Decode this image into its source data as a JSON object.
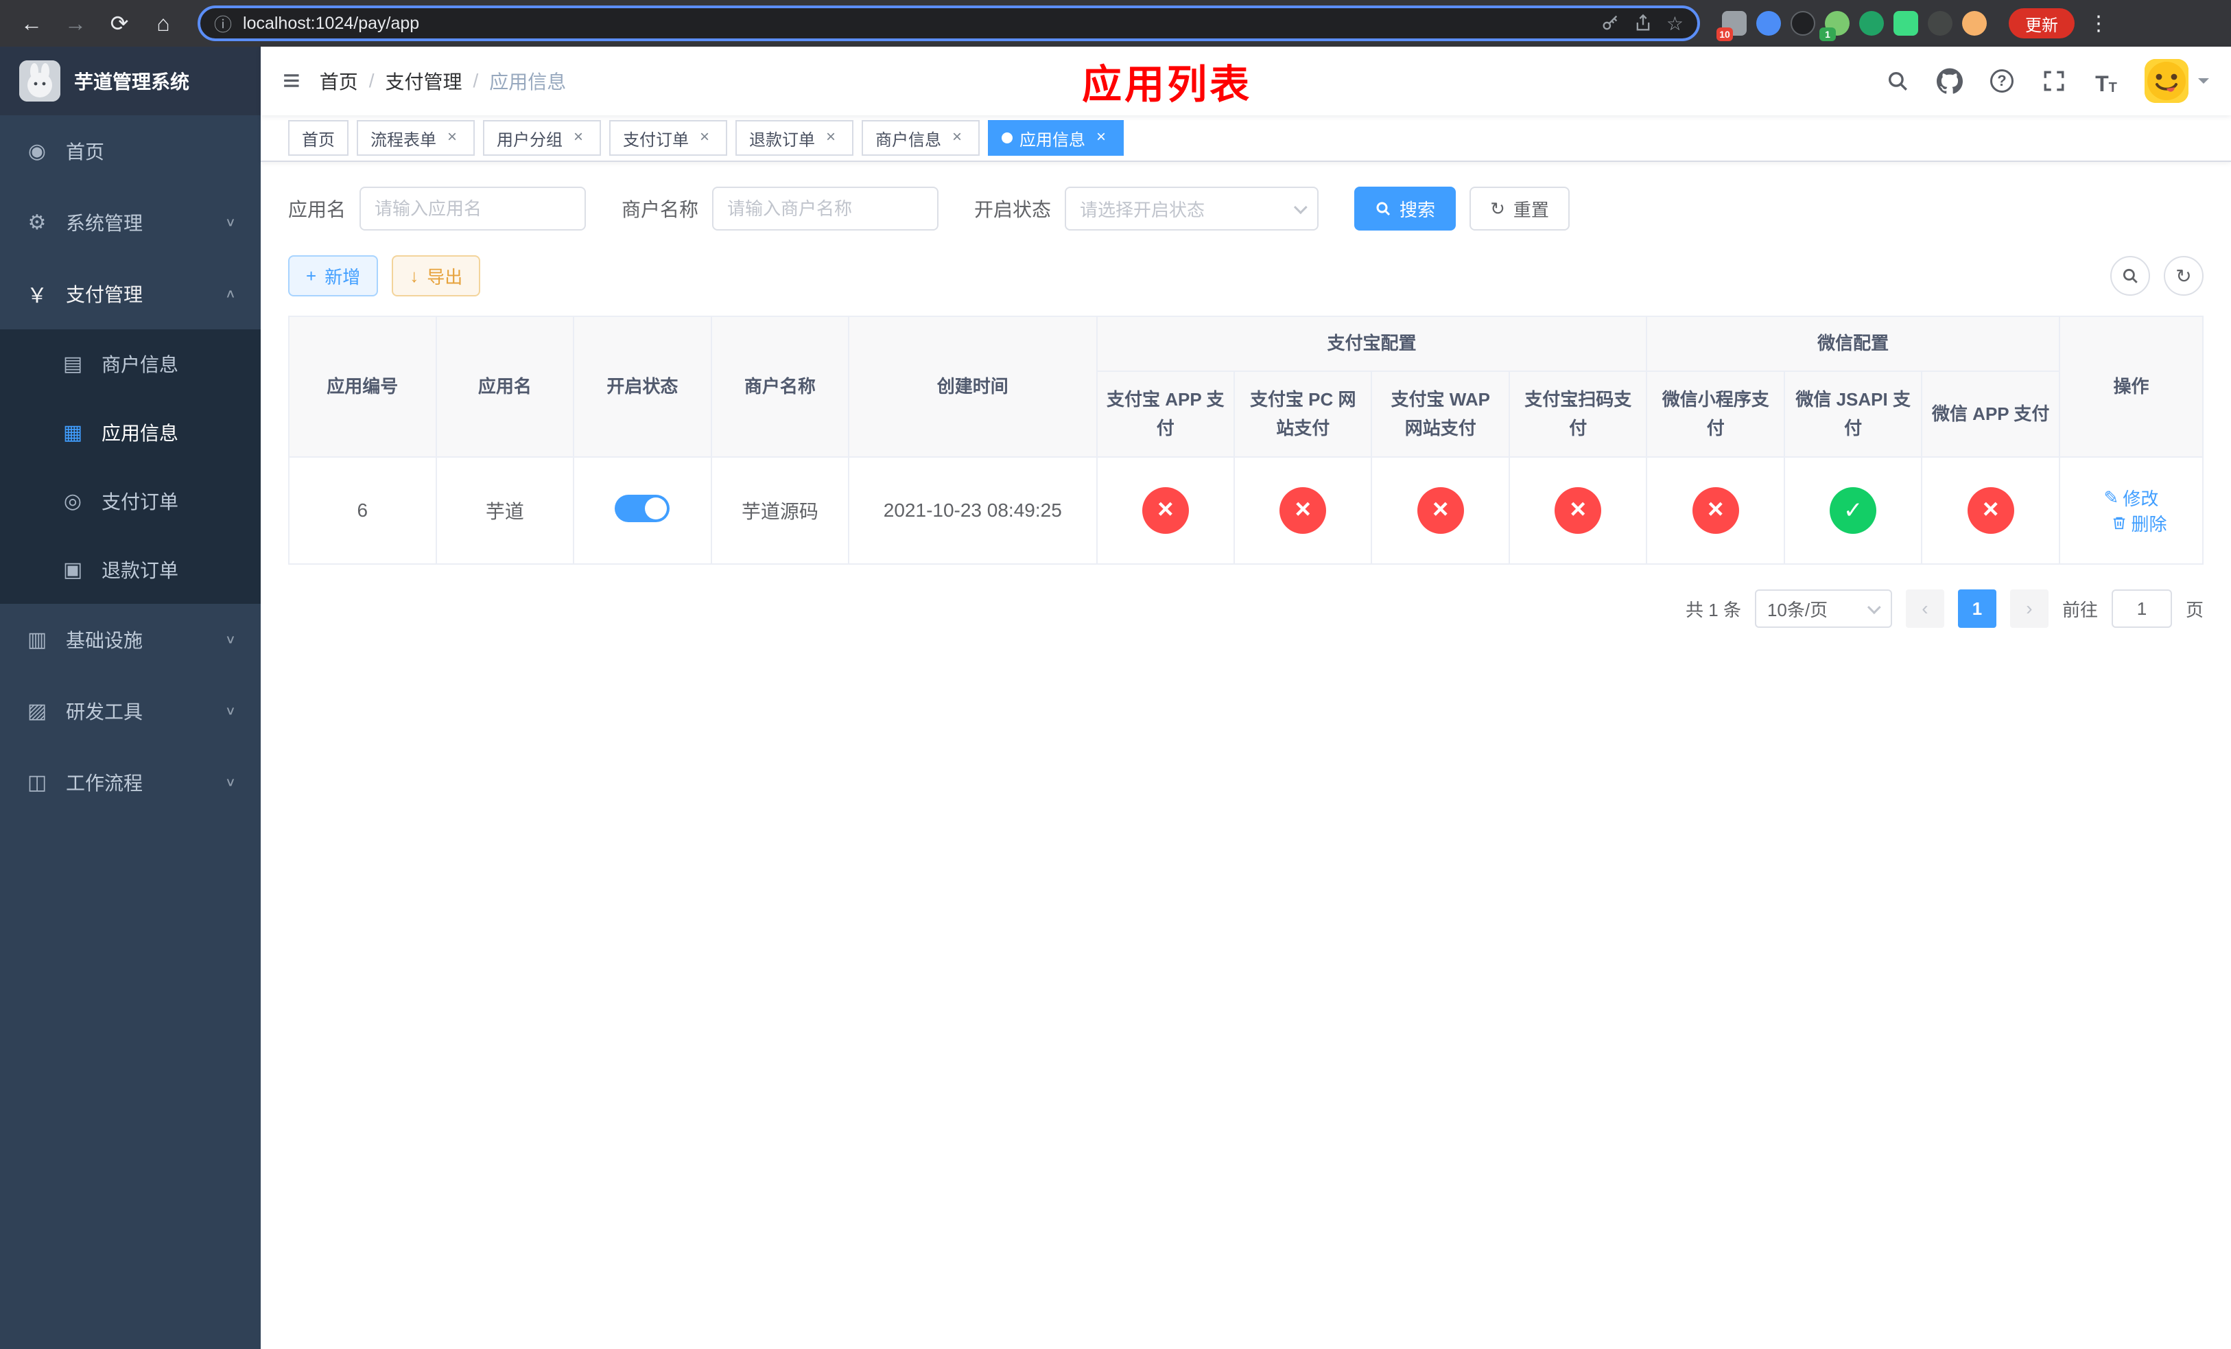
{
  "browser": {
    "url": "localhost:1024/pay/app",
    "update_button": "更新",
    "ext_badges": {
      "puzzle": "10",
      "avatar": "1"
    }
  },
  "icons": {
    "back": "←",
    "forward": "→",
    "reload": "⟳",
    "home": "⌂",
    "info": "ⓘ",
    "star": "☆",
    "menu_dots": "⋮",
    "hamburger": "≡",
    "dashboard": "◉",
    "gear": "⚙",
    "yen": "￥",
    "merchant": "▤",
    "app_grid": "▦",
    "pay_order": "◎",
    "refund_order": "▣",
    "infra": "▥",
    "devtool": "▨",
    "workflow": "◫",
    "chevron_down": "∨",
    "chevron_up": "∧",
    "close": "×",
    "question": "?",
    "font_size_large": "T",
    "font_size_small": "T",
    "plus": "+",
    "download": "↓",
    "refresh": "↻",
    "edit": "✎",
    "page_prev": "‹",
    "page_next": "›"
  },
  "sidebar": {
    "title": "芋道管理系统",
    "items": [
      {
        "label": "首页"
      },
      {
        "label": "系统管理"
      },
      {
        "label": "支付管理"
      },
      {
        "label": "基础设施"
      },
      {
        "label": "研发工具"
      },
      {
        "label": "工作流程"
      }
    ],
    "submenu": [
      {
        "label": "商户信息"
      },
      {
        "label": "应用信息"
      },
      {
        "label": "支付订单"
      },
      {
        "label": "退款订单"
      }
    ]
  },
  "header": {
    "breadcrumb": [
      {
        "label": "首页"
      },
      {
        "label": "支付管理"
      },
      {
        "label": "应用信息"
      }
    ],
    "page_title": "应用列表"
  },
  "tabs": [
    {
      "label": "首页"
    },
    {
      "label": "流程表单"
    },
    {
      "label": "用户分组"
    },
    {
      "label": "支付订单"
    },
    {
      "label": "退款订单"
    },
    {
      "label": "商户信息"
    },
    {
      "label": "应用信息"
    }
  ],
  "filters": {
    "app_name_label": "应用名",
    "app_name_placeholder": "请输入应用名",
    "merchant_label": "商户名称",
    "merchant_placeholder": "请输入商户名称",
    "status_label": "开启状态",
    "status_placeholder": "请选择开启状态",
    "search_button": "搜索",
    "reset_button": "重置"
  },
  "toolbar": {
    "add_button": "新增",
    "export_button": "导出"
  },
  "table": {
    "headers": {
      "app_id": "应用编号",
      "app_name": "应用名",
      "status": "开启状态",
      "merchant": "商户名称",
      "created": "创建时间",
      "alipay_group": "支付宝配置",
      "wechat_group": "微信配置",
      "alipay_app": "支付宝 APP 支付",
      "alipay_pc": "支付宝 PC 网站支付",
      "alipay_wap": "支付宝 WAP 网站支付",
      "alipay_qr": "支付宝扫码支付",
      "wx_mini": "微信小程序支付",
      "wx_jsapi": "微信 JSAPI 支付",
      "wx_app": "微信 APP 支付",
      "actions": "操作"
    },
    "rows": [
      {
        "app_id": "6",
        "app_name": "芋道",
        "status_on": "true",
        "merchant": "芋道源码",
        "created": "2021-10-23 08:49:25",
        "statuses": [
          "error",
          "error",
          "error",
          "error",
          "error",
          "success",
          "error"
        ],
        "edit_label": "修改",
        "delete_label": "删除"
      }
    ]
  },
  "pagination": {
    "total": "共 1 条",
    "page_size": "10条/页",
    "current_page": "1",
    "goto_label": "前往",
    "goto_value": "1",
    "goto_suffix": "页"
  },
  "colors": {
    "primary": "#409eff",
    "success": "#13ce66",
    "danger": "#ff4949",
    "warning": "#e6a23c",
    "banner": "#ff0000"
  }
}
